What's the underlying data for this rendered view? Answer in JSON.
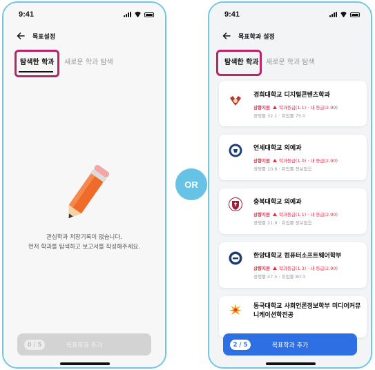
{
  "status_time": "9:41",
  "left_phone": {
    "appbar_title": "목표설정",
    "tabs": [
      {
        "label": "탐색한 학과"
      },
      {
        "label": "새로운 학과 탐색"
      }
    ],
    "empty_message": {
      "line1": "관심학과 저장기록이 없습니다.",
      "line2": "먼저 학과를 탐색하고 보고서를 작성해주세요."
    },
    "bottom_button": {
      "count": "0 / 5",
      "label": "목표학과 추가"
    }
  },
  "right_phone": {
    "appbar_title": "목표학과 설정",
    "tabs": [
      {
        "label": "탐색한 학과"
      },
      {
        "label": "새로운 학과 탐색"
      }
    ],
    "cards": [
      {
        "name": "경희대학교 디지털콘텐츠학과",
        "level": "상향지원",
        "grade": "학과등급(1.1) · 내 등급(2.90)",
        "meta": "경쟁률 32.1 · 취업률 75.0"
      },
      {
        "name": "연세대학교 의예과",
        "level": "상향지원",
        "grade": "학과등급(1.0) · 내 등급(2.90)",
        "meta": "경쟁률 10.6 · 취업률 정보없음"
      },
      {
        "name": "충북대학교 의예과",
        "level": "상향지원",
        "grade": "학과등급(1.1) · 내 등급(2.90)",
        "meta": "경쟁률 21.9 · 취업률 정보없음"
      },
      {
        "name": "한양대학교 컴퓨터소프트웨어학부",
        "level": "상향지원",
        "grade": "학과등급(1.3) · 내 등급(2.90)",
        "meta": "경쟁률 47.5 · 취업률 80.3"
      },
      {
        "name": "동국대학교 사회언론정보학부 미디어커뮤니케이션학전공",
        "level": "",
        "grade": "",
        "meta": ""
      }
    ],
    "bottom_button": {
      "count": "2 / 5",
      "label": "목표학과 추가"
    }
  },
  "or_label": "OR",
  "colors": {
    "frame": "#6cc6e6",
    "highlight": "#b8246a",
    "primary": "#2f6fe4",
    "disabled": "#d3d3d3",
    "grade_red": "#e0304a",
    "or_badge": "#66c3e6"
  },
  "icons": [
    "back-arrow-icon",
    "signal-icon",
    "wifi-icon",
    "battery-icon",
    "pencil-icon",
    "triangle-up-icon",
    "university-logo-icon"
  ]
}
